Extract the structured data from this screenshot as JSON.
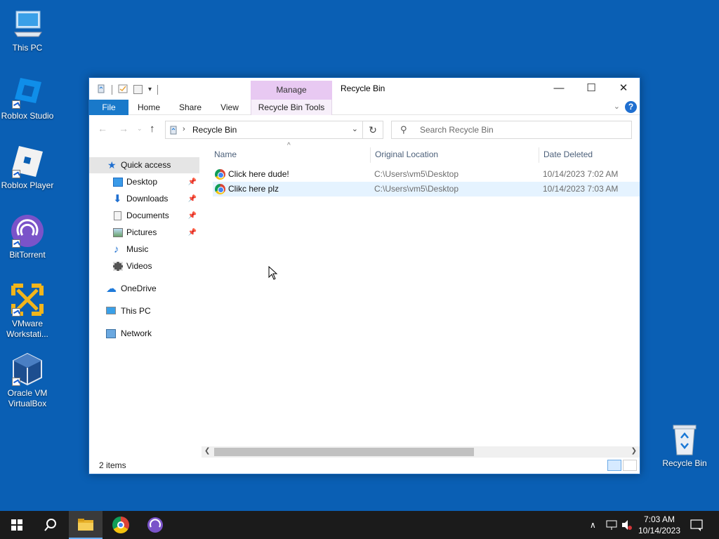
{
  "desktop": {
    "icons": [
      {
        "label": "This PC",
        "icon": "computer-icon"
      },
      {
        "label": "Roblox Studio",
        "icon": "roblox-studio-icon"
      },
      {
        "label": "Roblox Player",
        "icon": "roblox-player-icon"
      },
      {
        "label": "BitTorrent",
        "icon": "bittorrent-icon"
      },
      {
        "label": "VMware Workstati...",
        "icon": "vmware-icon"
      },
      {
        "label": "Oracle VM VirtualBox",
        "icon": "virtualbox-icon"
      },
      {
        "label": "Recycle Bin",
        "icon": "recycle-bin-icon"
      }
    ]
  },
  "window": {
    "title": "Recycle Bin",
    "manage_label": "Manage",
    "controls": {
      "minimize": "—",
      "maximize": "☐",
      "close": "✕"
    }
  },
  "ribbon": {
    "tabs": [
      "File",
      "Home",
      "Share",
      "View",
      "Recycle Bin Tools"
    ]
  },
  "address": {
    "path": "Recycle Bin",
    "search_placeholder": "Search Recycle Bin"
  },
  "sidebar": {
    "items": [
      {
        "label": "Quick access",
        "icon": "star-icon",
        "pinned": false
      },
      {
        "label": "Desktop",
        "icon": "desktop-folder-icon",
        "pinned": true
      },
      {
        "label": "Downloads",
        "icon": "download-arrow-icon",
        "pinned": true
      },
      {
        "label": "Documents",
        "icon": "documents-icon",
        "pinned": true
      },
      {
        "label": "Pictures",
        "icon": "pictures-icon",
        "pinned": true
      },
      {
        "label": "Music",
        "icon": "music-note-icon",
        "pinned": false
      },
      {
        "label": "Videos",
        "icon": "film-icon",
        "pinned": false
      },
      {
        "label": "OneDrive",
        "icon": "cloud-icon",
        "pinned": false
      },
      {
        "label": "This PC",
        "icon": "computer-icon",
        "pinned": false
      },
      {
        "label": "Network",
        "icon": "network-icon",
        "pinned": false
      }
    ]
  },
  "columns": {
    "name": "Name",
    "location": "Original Location",
    "date": "Date Deleted"
  },
  "files": [
    {
      "name": "Click here dude!",
      "location": "C:\\Users\\vm5\\Desktop",
      "date": "10/14/2023 7:02 AM"
    },
    {
      "name": "Clikc here plz",
      "location": "C:\\Users\\vm5\\Desktop",
      "date": "10/14/2023 7:03 AM"
    }
  ],
  "status": {
    "count": "2 items"
  },
  "taskbar": {
    "time": "7:03 AM",
    "date": "10/14/2023"
  },
  "colors": {
    "desktop_bg": "#0a5fb4",
    "file_tab": "#1979ca",
    "manage_tab": "#e8c9f2",
    "taskbar": "#1b1b1b"
  }
}
